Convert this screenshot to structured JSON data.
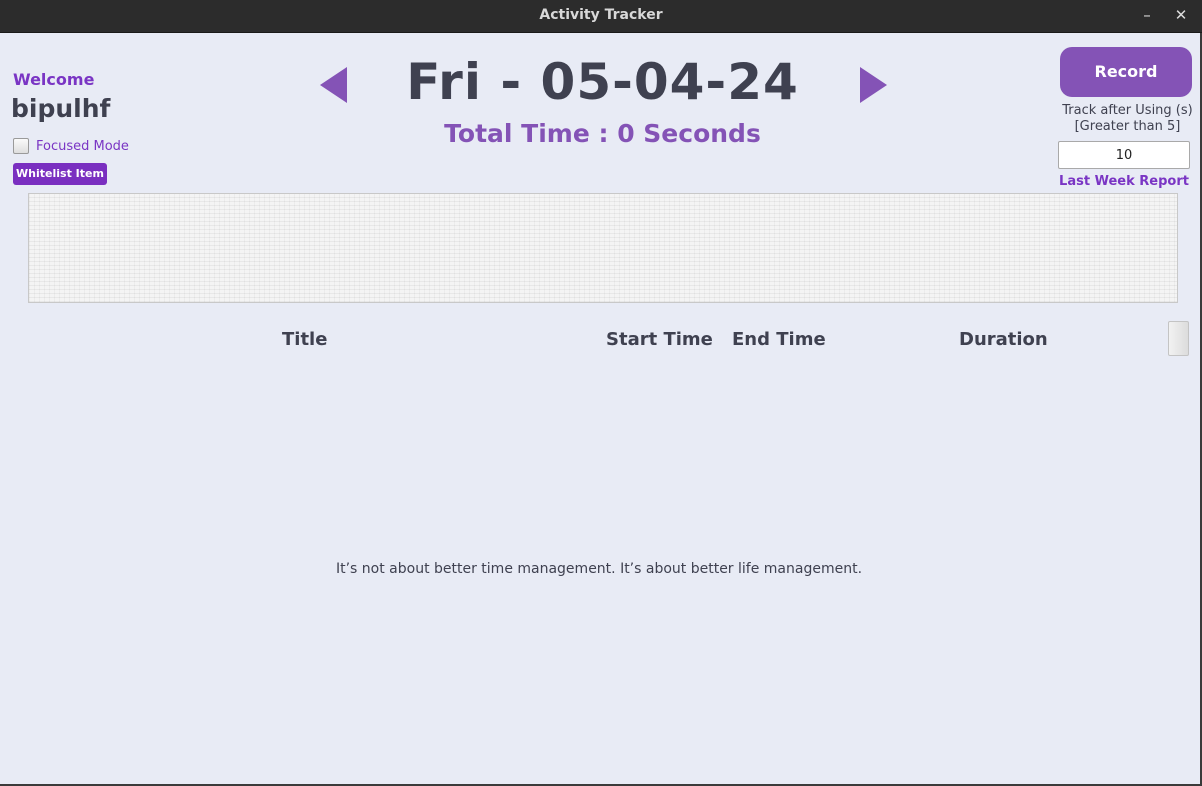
{
  "window": {
    "title": "Activity Tracker",
    "minimize_label": "–",
    "close_label": "✕"
  },
  "user": {
    "welcome": "Welcome",
    "username": "bipulhf"
  },
  "focused_mode": {
    "label": "Focused Mode",
    "checked": false
  },
  "whitelist_button": "Whitelist Item",
  "date_nav": {
    "date": "Fri - 05-04-24",
    "total_time": "Total Time : 0 Seconds",
    "prev_icon": "triangle-left-icon",
    "next_icon": "triangle-right-icon"
  },
  "record": {
    "button_label": "Record",
    "track_label_line1": "Track after Using (s)",
    "track_label_line2": "[Greater than 5]",
    "track_value": "10",
    "last_week_report": "Last Week Report"
  },
  "table": {
    "columns": [
      "Title",
      "Start Time",
      "End Time",
      "Duration"
    ],
    "rows": []
  },
  "quote": "It’s not about better time management. It’s about better life management.",
  "colors": {
    "accent": "#8453b6",
    "accent_dark": "#7a35c4",
    "text_dark": "#3f4150",
    "background": "#e8ebf5",
    "titlebar": "#2c2c2c"
  }
}
